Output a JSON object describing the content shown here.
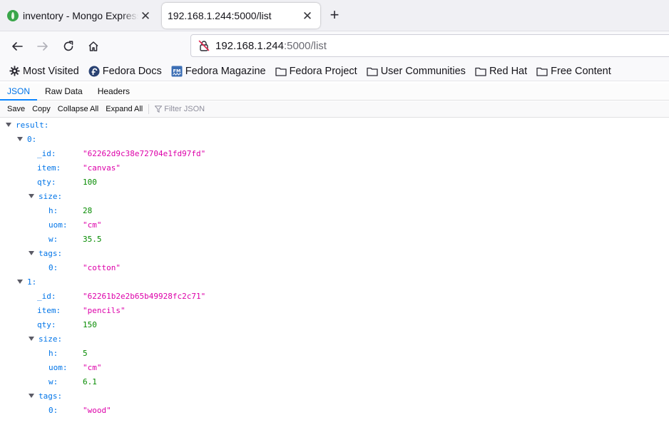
{
  "browser": {
    "tabs": [
      {
        "title": "inventory - Mongo Express",
        "active": false
      },
      {
        "title": "192.168.1.244:5000/list",
        "active": true
      }
    ],
    "urlbar": {
      "host": "192.168.1.244",
      "path": ":5000/list"
    },
    "bookmarks": [
      {
        "label": "Most Visited",
        "icon": "gear-icon"
      },
      {
        "label": "Fedora Docs",
        "icon": "fedora-icon"
      },
      {
        "label": "Fedora Magazine",
        "icon": "fedora-magazine-icon"
      },
      {
        "label": "Fedora Project",
        "icon": "folder-icon"
      },
      {
        "label": "User Communities",
        "icon": "folder-icon"
      },
      {
        "label": "Red Hat",
        "icon": "folder-icon"
      },
      {
        "label": "Free Content",
        "icon": "folder-icon"
      }
    ]
  },
  "json_viewer": {
    "tabs": [
      "JSON",
      "Raw Data",
      "Headers"
    ],
    "active_tab": "JSON",
    "toolbar": {
      "save": "Save",
      "copy": "Copy",
      "collapse_all": "Collapse All",
      "expand_all": "Expand All",
      "filter_placeholder": "Filter JSON"
    },
    "tree": {
      "root_key": "result:",
      "items": [
        {
          "index": "0:",
          "id_key": "_id:",
          "id": "\"62262d9c38e72704e1fd97fd\"",
          "item_key": "item:",
          "item": "\"canvas\"",
          "qty_key": "qty:",
          "qty": "100",
          "size_key": "size:",
          "h_key": "h:",
          "h": "28",
          "uom_key": "uom:",
          "uom": "\"cm\"",
          "w_key": "w:",
          "w": "35.5",
          "tags_key": "tags:",
          "tag0_key": "0:",
          "tag0": "\"cotton\""
        },
        {
          "index": "1:",
          "id_key": "_id:",
          "id": "\"62261b2e2b65b49928fc2c71\"",
          "item_key": "item:",
          "item": "\"pencils\"",
          "qty_key": "qty:",
          "qty": "150",
          "size_key": "size:",
          "h_key": "h:",
          "h": "5",
          "uom_key": "uom:",
          "uom": "\"cm\"",
          "w_key": "w:",
          "w": "6.1",
          "tags_key": "tags:",
          "tag0_key": "0:",
          "tag0": "\"wood\""
        }
      ]
    },
    "colors": {
      "key": "#0074e8",
      "string": "#dd00a9",
      "number": "#058b00"
    }
  }
}
